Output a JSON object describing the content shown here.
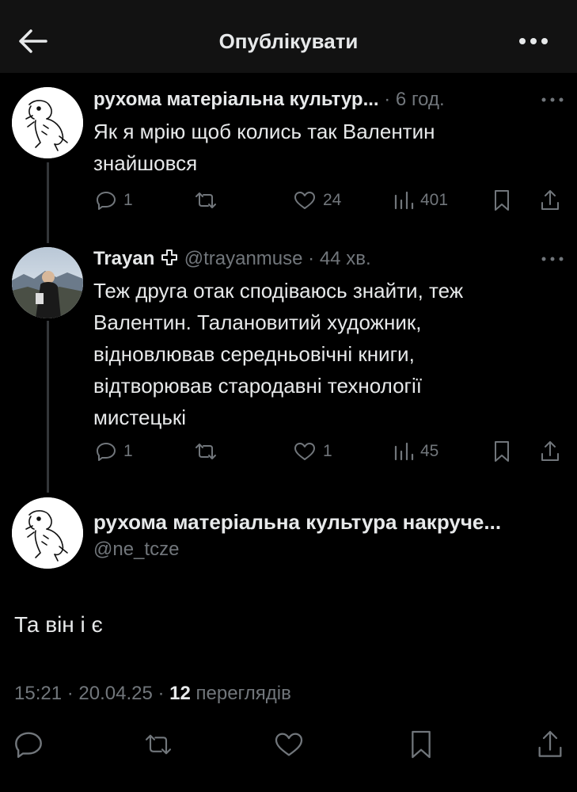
{
  "topbar": {
    "title": "Опублікувати",
    "back_icon": "arrow-left-icon",
    "more_icon": "more-horizontal-icon"
  },
  "posts": [
    {
      "name": "рухома матеріальна культур...",
      "time": "· 6 год.",
      "text_lines": [
        "Як я мрію щоб колись так Валентин",
        "знайшовся"
      ],
      "replies": "1",
      "reposts": "",
      "likes": "24",
      "views": "401"
    },
    {
      "name": "Trayan",
      "handle": "@trayanmuse",
      "time": "· 44 хв.",
      "text_lines": [
        "Теж друга отак сподіваюсь знайти, теж",
        "Валентин. Талановитий художник,",
        "відновлював середньовічні книги,",
        "відтворював стародавні технології",
        "мистецькі"
      ],
      "replies": "1",
      "reposts": "",
      "likes": "1",
      "views": "45"
    }
  ],
  "main_post": {
    "name": "рухома матеріальна культура накруче...",
    "handle": "@ne_tcze",
    "text": "Та він і є",
    "time_date": "15:21 · 20.04.25 · ",
    "views_count": "12",
    "views_label": " переглядів"
  },
  "colors": {
    "background": "#000000",
    "topbar": "#121212",
    "text": "#e7e9ea",
    "muted": "#71767b",
    "thread_line": "#333639"
  }
}
